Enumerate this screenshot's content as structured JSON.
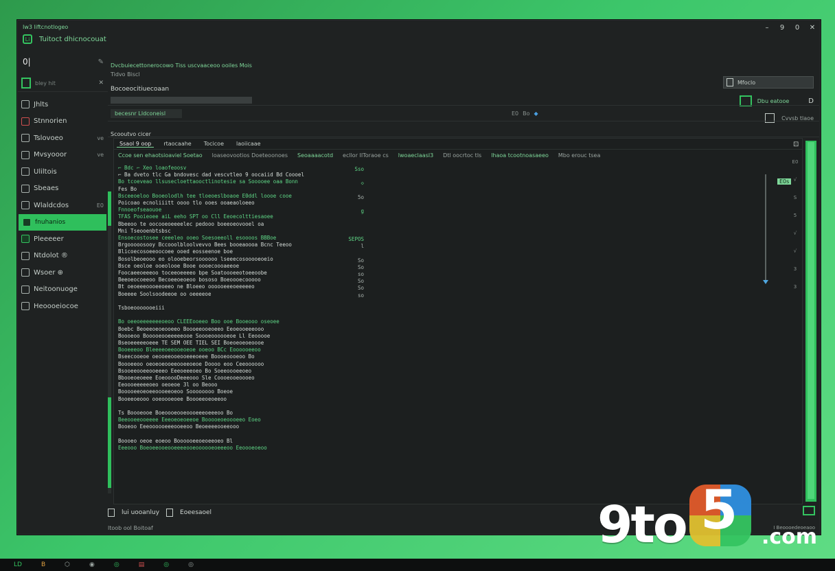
{
  "window": {
    "app_tag": "Iw3 liftcnotlogeo",
    "logo_glyph": "Li",
    "title": "Tuitoct dhicnocouat",
    "controls": [
      "–",
      "9",
      "0",
      "✕"
    ]
  },
  "sidebar": {
    "pane_icon": "0|",
    "edit_icon": "✎",
    "search_label": "bley hit",
    "search_close": "✕",
    "items": [
      {
        "label": "Jhlts",
        "icon": "grid-icon"
      },
      {
        "label": "Stnnorien",
        "icon": "book-icon"
      },
      {
        "label": "Tslovoeo",
        "icon": "file-icon",
        "trail": "ve"
      },
      {
        "label": "Mvsyooor",
        "icon": "folder-icon",
        "trail": "ve"
      },
      {
        "label": "Uliltois",
        "icon": "doc-icon"
      },
      {
        "label": "Sbeaes",
        "icon": "sheet-icon"
      },
      {
        "label": "Wlaldcdos",
        "icon": "list-icon",
        "trail": "E0"
      },
      {
        "label": "fnuhanios",
        "icon": "active-icon",
        "active": true
      },
      {
        "label": "Pleeeeer",
        "icon": "green-icon"
      },
      {
        "label": "Ntdolot ®",
        "icon": "box-icon"
      },
      {
        "label": "Wsoer ⊕",
        "icon": "page-icon"
      },
      {
        "label": "Neitoonuoge",
        "icon": "note-icon"
      },
      {
        "label": "Heoooeiocoe",
        "icon": "tag-icon"
      }
    ]
  },
  "header": {
    "crumbs": "Dvcbuiecettonerocowo  Tiss  uscvaaceoo ooiles  Mois",
    "crumbs2": "Tidvo Biscl",
    "path": "Bocoeocitiuecoaan"
  },
  "filter": {
    "chip": "becesnr Lldconeisl",
    "icons": [
      "E0",
      "Bo",
      "◆"
    ]
  },
  "right_tools": {
    "field_label": "Mfoclo",
    "tool_label": "Dbu eatooe",
    "tool_doc": "D",
    "tool2_label": "Cvvsb tlaoe"
  },
  "section_label": "Scooutvo cicer",
  "panel": {
    "tabs": [
      "Ssaol 9 oop",
      "rtaocaahe",
      "Tocicoe",
      "laoiicaae"
    ],
    "columns": [
      "Ccoe  sen ehaotsioaviel  Soetao",
      "loaseovootios Doeteoonoes",
      "Seoaaaacotd",
      "ecllor IIToraoe cs",
      "lwoaeclaasl3",
      "Dtl oocrtoc tls",
      "lhaoa tcootnoasaeeo",
      "Mbo erouc tsea"
    ],
    "badge": "E0s",
    "corner": "⊡",
    "ticks": [
      "E0",
      "√",
      "S",
      "5",
      "√",
      "√",
      "3",
      "3"
    ]
  },
  "log_lines": [
    {
      "t": "⌐ Bdc ⌐ Xeo loaofeoosv",
      "c": "g"
    },
    {
      "t": "⌐ Ba dveto tlc Ga bndovesc dad vescvtleo  9 oocaiid Bd Coooel",
      "c": "w"
    },
    {
      "t": "Bo tcoeveao llsusecloettaooctlinotesie  sa  Sooooee oaa Bonn",
      "c": "g"
    },
    {
      "t": "Fes Bo",
      "c": "w"
    },
    {
      "t": "Bsceeoeloo Booeolodlh tee tloeoeslboaoe  E0ddl loooe cooe",
      "c": "g"
    },
    {
      "t": "Poicoao ecnoliiitt oooo tlo ooes ooaeaoloeeo",
      "c": "w"
    },
    {
      "t": "Fnnoeofseaouoe",
      "c": "g"
    },
    {
      "t": "TFAS Pooieoee aiL eeho SPT oo  Cll Eeoecolttiesaoee",
      "c": "g"
    },
    {
      "t": "Bbeeoo te oocooeoeeeelec  pedooo boeeoeovooel oa",
      "c": "w"
    },
    {
      "t": "Mni Tseooenbtsbsc",
      "c": "w"
    },
    {
      "t": "Ensoecostosee ceeeleo ooeo  Soesoeeoll esoooos BBBoe",
      "c": "g"
    },
    {
      "t": "Brgooooosooy Bccooolbloolvevvo  Bees booeaoooa Bcnc  Teeoo",
      "c": "w"
    },
    {
      "t": "Blicoecosoeeoocoee ooed eosseenoe boe",
      "c": "w"
    },
    {
      "t": "Bosolbeoeooo eo olooebeorsoooooo  lseeecosooooeoeio",
      "c": "w"
    },
    {
      "t": "Bsce oeoloe ooeolooe  Booe oooecoooaeeoe",
      "c": "w"
    },
    {
      "t": "Foocaeeoeeeoo toceeoeeeeo  bpe Soatoooeeotoeeoobe",
      "c": "w"
    },
    {
      "t": "Beeoeocoeeoo Becoeeoeoeoo  bososo Boeoooecooooo",
      "c": "w"
    },
    {
      "t": "Bt oeoeeeoooeeoeeo  ne Bloeeo oooooeeeoeeeeeo",
      "c": "w"
    },
    {
      "t": "Boeeee Soolsoodeeoe oo oeeeeoe",
      "c": "w"
    },
    {
      "t": "",
      "c": "w"
    },
    {
      "t": "Tsboeooooooeiii",
      "c": "w"
    },
    {
      "t": "",
      "c": "w"
    },
    {
      "t": "Bo oeeoeeeeeeeoeoo CLEEEooeeo  Boo ooe Booeooo oseoee",
      "c": "g"
    },
    {
      "t": "Boebc Beoeeoeoeooeeo  Boooeeooeoeeo  Eeoeooeeeooo",
      "c": "w"
    },
    {
      "t": "Boooeoo Booooeooeeeeeooe  Soooeoooooeoe  Ll Eeooooe",
      "c": "w"
    },
    {
      "t": "Bseoeeeeeoeee TE SEM OEE TIEL SEI  Boeoeoeoeoooe",
      "c": "w"
    },
    {
      "t": "Booeeeoo Bleeeeoeeooeoeoe  ooeoo BCc Eoooooeeoo",
      "c": "g"
    },
    {
      "t": "Bseecooeoe oeooeeooeooeeeoeee  Boooeoooeoo Bo",
      "c": "w"
    },
    {
      "t": "Boooeeoo oeoeoeooeeooeeoeoe  Doooo eoo Ceeoooooo",
      "c": "w"
    },
    {
      "t": "Bsooeeooeeooeeeo Eeeoeeeoeo  Bo Soeeoooeeoeo",
      "c": "w"
    },
    {
      "t": "Bbooeoeoeee EoeooooDeeeooo  Sle Coooeooeoooeo",
      "c": "w"
    },
    {
      "t": "Eeoooeeeeeoeo oeoeoe 3l  oo Beooo",
      "c": "w"
    },
    {
      "t": "Booooeeoeoeeoooeeoeoo  Soooooooo Boeoe",
      "c": "w"
    },
    {
      "t": "Booeeoeooo ooeoooeoee  Boooeeoeoeeoo",
      "c": "w"
    },
    {
      "t": "",
      "c": "w"
    },
    {
      "t": "Ts Boooeooe  Boeoooeooeoooeeeoeeeoo  Bo",
      "c": "w"
    },
    {
      "t": "Beeooeeooeeee Eeeoeoeoeeoe Booooeoeoooeeo Eoeo",
      "c": "g"
    },
    {
      "t": "Booeoo Eeeoooooeeeooeeoo  Beoeeeeooeeooo",
      "c": "w"
    },
    {
      "t": "",
      "c": "w"
    },
    {
      "t": "Boooeo oeoe eoeoo  Boooooeeoeoeeoeo  Bl",
      "c": "w"
    },
    {
      "t": "Eeeooo Boeoeeooeooeeeeooeoooooeoeeeoo Eeoooeoeoo",
      "c": "g"
    }
  ],
  "log_side": [
    {
      "t": "Sso",
      "c": "g"
    },
    {
      "t": "",
      "c": "w"
    },
    {
      "t": "◇",
      "c": "g"
    },
    {
      "t": "",
      "c": "w"
    },
    {
      "t": "5o",
      "c": "w"
    },
    {
      "t": "",
      "c": "w"
    },
    {
      "t": "g",
      "c": "g"
    },
    {
      "t": "",
      "c": "w"
    },
    {
      "t": "",
      "c": "w"
    },
    {
      "t": "",
      "c": "w"
    },
    {
      "t": "SEPOS",
      "c": "g"
    },
    {
      "t": "l",
      "c": "w"
    },
    {
      "t": "",
      "c": "w"
    },
    {
      "t": "So",
      "c": "w"
    },
    {
      "t": "So",
      "c": "w"
    },
    {
      "t": "so",
      "c": "w"
    },
    {
      "t": "So",
      "c": "w"
    },
    {
      "t": "So",
      "c": "w"
    },
    {
      "t": "so",
      "c": "w"
    }
  ],
  "footer": {
    "line1": "lui uooanluy",
    "line1b": "Eoeesaoel",
    "line2": "ltoob  ooI Boitoaf",
    "right": "I Beoooedeoeaoo"
  },
  "taskbar": {
    "items": [
      {
        "label": "LD",
        "tone": "green"
      },
      {
        "label": "B",
        "tone": "orange"
      },
      {
        "label": "⬡",
        "tone": "plain"
      },
      {
        "label": "◉",
        "tone": "plain"
      },
      {
        "label": "◎",
        "tone": "green"
      },
      {
        "label": "▤",
        "tone": "red"
      },
      {
        "label": "◎",
        "tone": "green"
      },
      {
        "label": "◎",
        "tone": "plain"
      }
    ]
  },
  "watermark": {
    "brand": "9to",
    "digit": "5",
    "suffix": ".com"
  }
}
